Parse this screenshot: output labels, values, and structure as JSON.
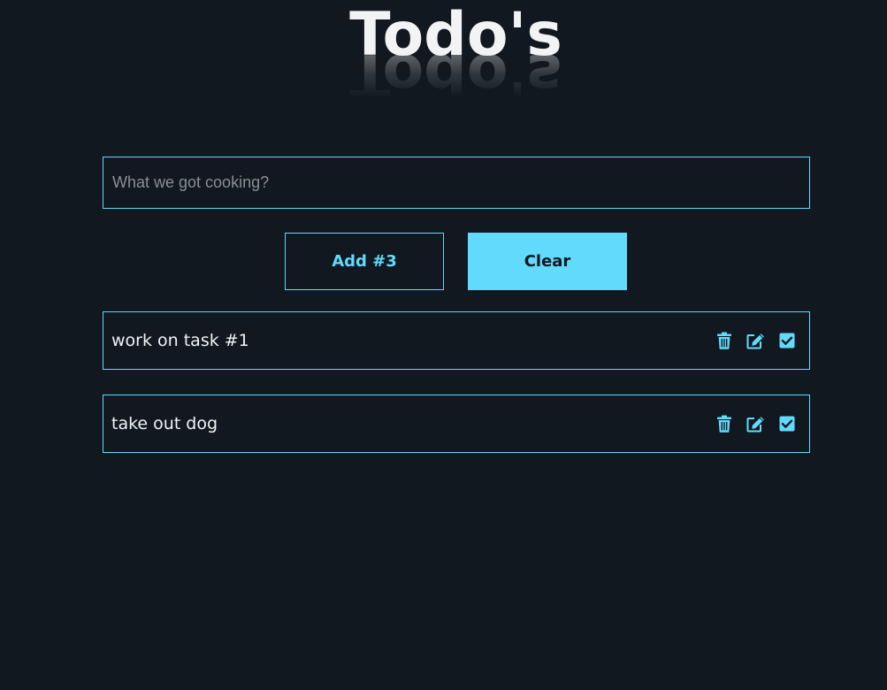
{
  "header": {
    "title": "Todo's"
  },
  "form": {
    "input_placeholder": "What we got cooking?",
    "input_value": "",
    "add_label": "Add #3",
    "clear_label": "Clear"
  },
  "todos": [
    {
      "text": "work on task #1"
    },
    {
      "text": "take out dog"
    }
  ],
  "icons": {
    "delete": "trash-icon",
    "edit": "edit-icon",
    "complete": "check-square-icon"
  },
  "colors": {
    "background": "#111820",
    "accent": "#61dafb",
    "text": "#f2f3f5",
    "placeholder": "#8a8f96"
  }
}
